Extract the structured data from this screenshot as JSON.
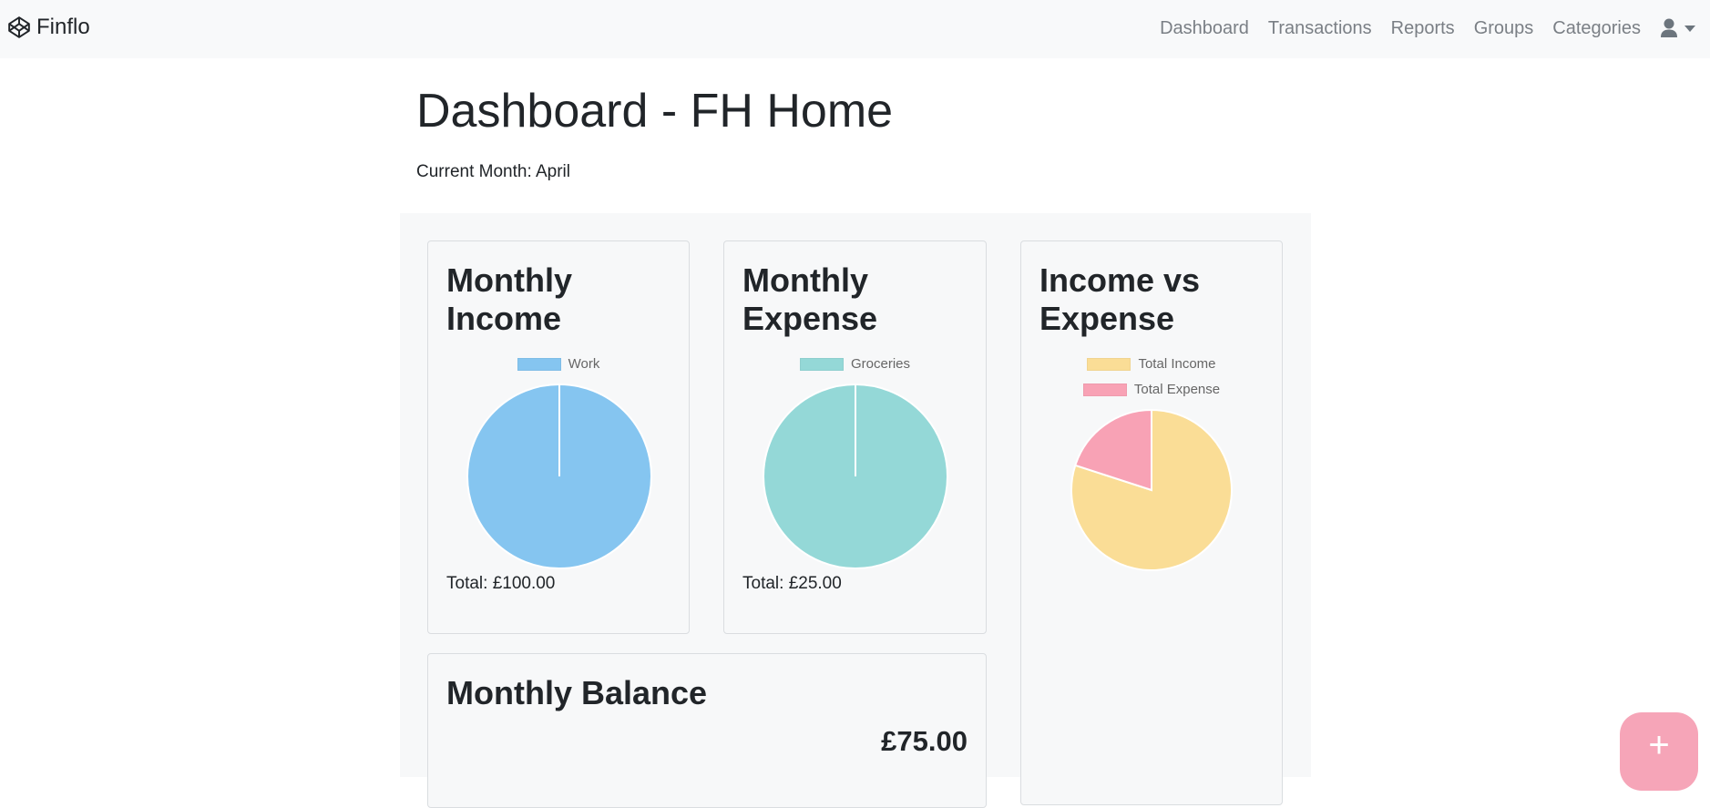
{
  "navbar": {
    "brand": "Finflo",
    "brand_icon": "codepen-logo-icon",
    "links": [
      "Dashboard",
      "Transactions",
      "Reports",
      "Groups",
      "Categories"
    ],
    "user_icon": "user-icon",
    "colors": {
      "background": "#f8f9fa",
      "link": "#7a7f85"
    }
  },
  "header": {
    "title_prefix": "Dashboard - ",
    "group_name": "FH Home",
    "current_month": "Current Month: April"
  },
  "cards": {
    "monthly_income": {
      "title": "Monthly Income",
      "total": "Total: £100.00",
      "chart_data": {
        "type": "pie",
        "labels": [
          "Work"
        ],
        "values": [
          100
        ],
        "colors": [
          "#85c5f0"
        ]
      }
    },
    "monthly_expense": {
      "title": "Monthly Expense",
      "total": "Total: £25.00",
      "chart_data": {
        "type": "pie",
        "labels": [
          "Groceries"
        ],
        "values": [
          25
        ],
        "colors": [
          "#94d8d7"
        ]
      }
    },
    "income_vs_expense": {
      "title": "Income vs Expense",
      "chart_data": {
        "type": "pie",
        "labels": [
          "Total Income",
          "Total Expense"
        ],
        "values": [
          100,
          25
        ],
        "colors": [
          "#fadd96",
          "#f8a2b5"
        ]
      }
    },
    "monthly_balance": {
      "title": "Monthly Balance",
      "amount": "£75.00"
    }
  },
  "fab": {
    "label": "+",
    "color": "#f6a5b8"
  }
}
